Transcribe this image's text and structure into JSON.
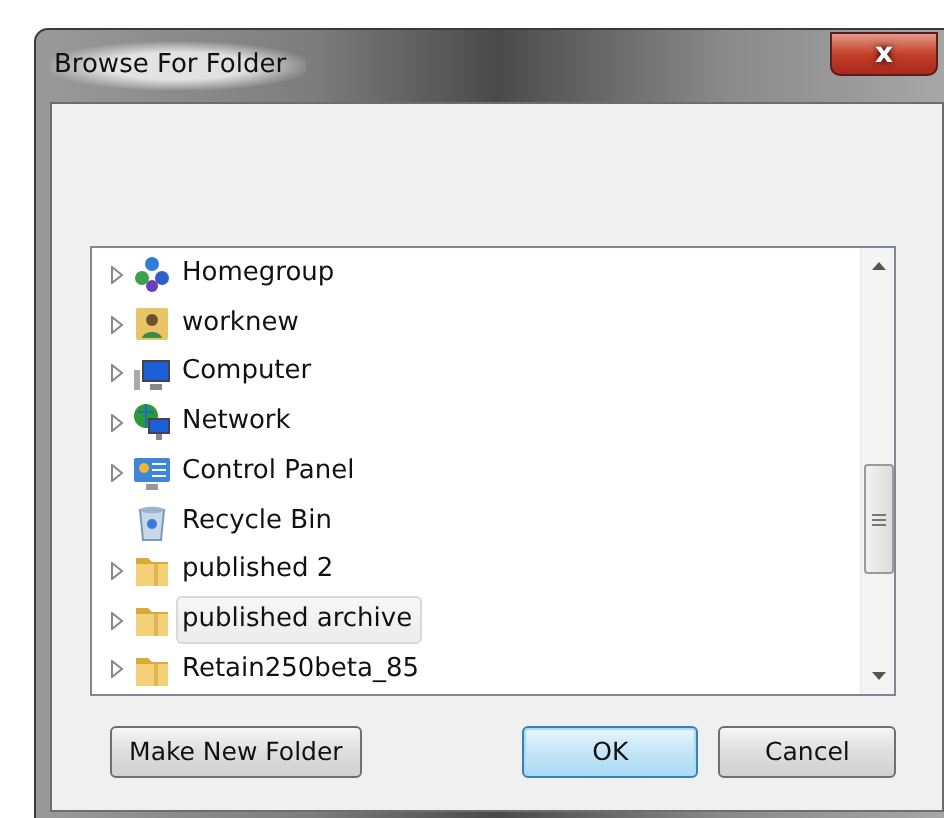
{
  "window": {
    "title": "Browse For Folder",
    "close_label": "x"
  },
  "tree": {
    "items": [
      {
        "label": "Homegroup",
        "kind": "homegroup",
        "expandable": true,
        "selected": false
      },
      {
        "label": "worknew",
        "kind": "user",
        "expandable": true,
        "selected": false
      },
      {
        "label": "Computer",
        "kind": "computer",
        "expandable": true,
        "selected": false
      },
      {
        "label": "Network",
        "kind": "network",
        "expandable": true,
        "selected": false
      },
      {
        "label": "Control Panel",
        "kind": "control",
        "expandable": true,
        "selected": false
      },
      {
        "label": "Recycle Bin",
        "kind": "recycle",
        "expandable": false,
        "selected": false
      },
      {
        "label": "published 2",
        "kind": "folder",
        "expandable": true,
        "selected": false
      },
      {
        "label": "published archive",
        "kind": "folder",
        "expandable": true,
        "selected": true
      },
      {
        "label": "Retain250beta_85",
        "kind": "folder",
        "expandable": true,
        "selected": false
      }
    ]
  },
  "buttons": [
    {
      "label": "Make New Folder",
      "default": false
    },
    {
      "label": "OK",
      "default": true
    },
    {
      "label": "Cancel",
      "default": false
    }
  ]
}
